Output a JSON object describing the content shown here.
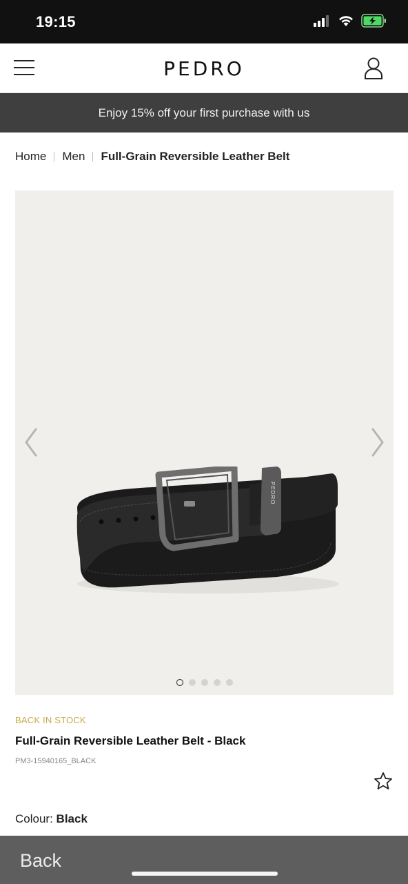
{
  "status_bar": {
    "time": "19:15",
    "icons": [
      "signal-icon",
      "wifi-icon",
      "battery-charging-icon"
    ]
  },
  "header": {
    "brand": "PEDRO",
    "menu_icon": "hamburger-menu-icon",
    "account_icon": "user-icon"
  },
  "promo": {
    "text": "Enjoy 15% off your first purchase with us"
  },
  "breadcrumb": {
    "items": [
      "Home",
      "Men",
      "Full-Grain Reversible Leather Belt"
    ]
  },
  "gallery": {
    "background": "#f0efec",
    "image_count": 5,
    "active_index": 0,
    "buckle_engraving": "PEDRO"
  },
  "product": {
    "stock_status": "BACK IN STOCK",
    "title": "Full-Grain Reversible Leather Belt - Black",
    "sku": "PM3-15940165_BLACK",
    "colour_label": "Colour:",
    "colour_value": "Black"
  },
  "bottom_bar": {
    "back_label": "Back"
  },
  "colors": {
    "status_bar": "#111111",
    "promo_bg": "#3f3f3f",
    "stock_accent": "#c7a94a",
    "bottom_bar": "#5e5e5e"
  }
}
